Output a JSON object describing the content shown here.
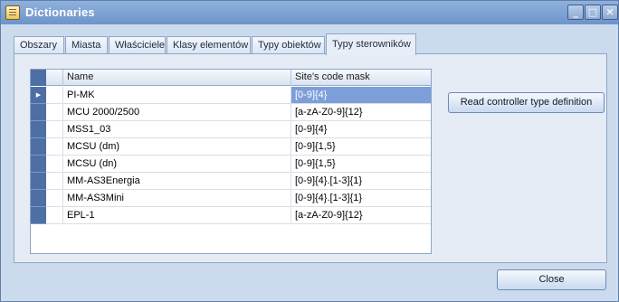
{
  "window": {
    "title": "Dictionaries",
    "icon": "dictionary-app-icon",
    "controls": {
      "minimize": "_",
      "maximize": "□",
      "close": "✕"
    }
  },
  "tabs": [
    {
      "label": "Obszary",
      "active": false
    },
    {
      "label": "Miasta",
      "active": false
    },
    {
      "label": "Właściciele",
      "active": false
    },
    {
      "label": "Klasy elementów",
      "active": false
    },
    {
      "label": "Typy obiektów",
      "active": false
    },
    {
      "label": "Typy sterowników",
      "active": true
    }
  ],
  "grid": {
    "columns": [
      "Name",
      "Site's code mask"
    ],
    "current_row_marker": "▶",
    "rows": [
      {
        "name": "PI-MK",
        "mask": "[0-9]{4}",
        "selected": true
      },
      {
        "name": "MCU 2000/2500",
        "mask": "[a-zA-Z0-9]{12}",
        "selected": false
      },
      {
        "name": "MSS1_03",
        "mask": "[0-9]{4}",
        "selected": false
      },
      {
        "name": "MCSU (dm)",
        "mask": "[0-9]{1,5}",
        "selected": false
      },
      {
        "name": "MCSU (dn)",
        "mask": "[0-9]{1,5}",
        "selected": false
      },
      {
        "name": "MM-AS3Energia",
        "mask": "[0-9]{4}.[1-3]{1}",
        "selected": false
      },
      {
        "name": "MM-AS3Mini",
        "mask": "[0-9]{4}.[1-3]{1}",
        "selected": false
      },
      {
        "name": "EPL-1",
        "mask": "[a-zA-Z0-9]{12}",
        "selected": false
      }
    ]
  },
  "buttons": {
    "read_definition": "Read controller type definition",
    "close": "Close"
  },
  "colors": {
    "titlebar": "#7fa3d6",
    "selection": "#7d9fd9",
    "row_header": "#4d6fa5"
  }
}
